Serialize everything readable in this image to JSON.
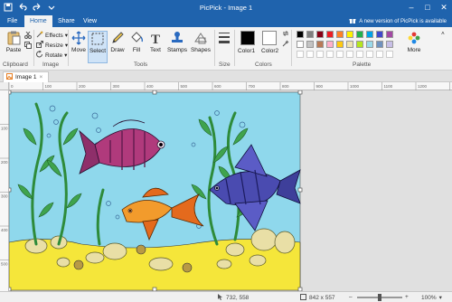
{
  "window": {
    "title": "PicPick - Image 1"
  },
  "menu_tabs": [
    {
      "label": "File",
      "active": false
    },
    {
      "label": "Home",
      "active": true
    },
    {
      "label": "Share",
      "active": false
    },
    {
      "label": "View",
      "active": false
    }
  ],
  "notice": {
    "text": "A new version of PicPick is available"
  },
  "ribbon": {
    "clipboard": {
      "paste_label": "Paste",
      "group_label": "Clipboard"
    },
    "image": {
      "effects_label": "Effects",
      "resize_label": "Resize",
      "rotate_label": "Rotate",
      "group_label": "Image"
    },
    "tools": {
      "move_label": "Move",
      "select_label": "Select",
      "draw_label": "Draw",
      "fill_label": "Fill",
      "text_label": "Text",
      "stamps_label": "Stamps",
      "shapes_label": "Shapes",
      "group_label": "Tools"
    },
    "size": {
      "group_label": "Size"
    },
    "colors": {
      "color1_label": "Color1",
      "color2_label": "Color2",
      "group_label": "Colors",
      "color1_value": "#000000",
      "color2_value": "#ffffff"
    },
    "palette": {
      "group_label": "Palette",
      "more_label": "More"
    }
  },
  "palette_colors": [
    "#000000",
    "#7f7f7f",
    "#880015",
    "#ed1c24",
    "#ff7f27",
    "#fff200",
    "#22b14c",
    "#00a2e8",
    "#3f48cc",
    "#a349a4",
    "#ffffff",
    "#c3c3c3",
    "#b97a57",
    "#ffaec9",
    "#ffc90e",
    "#efe4b0",
    "#b5e61d",
    "#99d9ea",
    "#7092be",
    "#c8bfe7"
  ],
  "document": {
    "tab_label": "Image 1"
  },
  "ruler": {
    "h_ticks": [
      "0",
      "100",
      "200",
      "300",
      "400",
      "500",
      "600",
      "700",
      "800",
      "900",
      "1000",
      "1100",
      "1200",
      "1300"
    ],
    "v_ticks": [
      "100",
      "200",
      "300",
      "400",
      "500"
    ]
  },
  "status": {
    "cursor": "732, 558",
    "size": "842 x 557",
    "zoom": "100%"
  },
  "colors": {
    "title_blue": "#1f63ad",
    "sky": "#8fd8ec",
    "sand": "#f5e63a"
  }
}
